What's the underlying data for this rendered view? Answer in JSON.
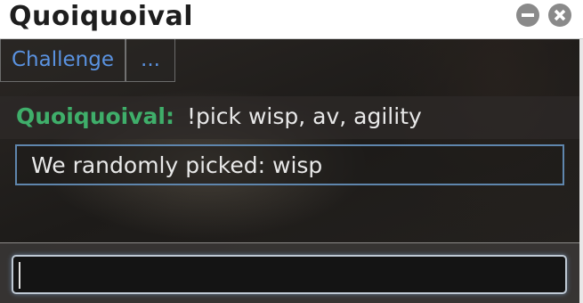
{
  "window": {
    "title": "Quoiquoival",
    "minimize_icon": "minus-circle-icon",
    "close_icon": "x-circle-icon"
  },
  "tabs": [
    {
      "label": "Challenge"
    },
    {
      "label": "..."
    }
  ],
  "chat": {
    "messages": [
      {
        "user": "Quoiquoival:",
        "text": "!pick wisp, av, agility",
        "user_color": "#3fae6a"
      }
    ],
    "notice": "We randomly picked:  wisp"
  },
  "input": {
    "value": "",
    "placeholder": ""
  }
}
